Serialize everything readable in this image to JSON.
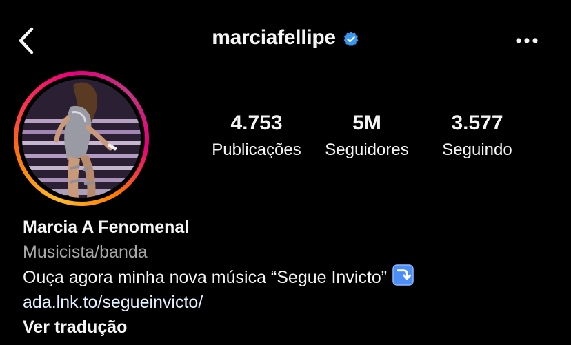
{
  "header": {
    "username": "marciafellipe",
    "back_icon": "chevron-left-icon",
    "verified_icon": "verified-badge-icon",
    "verified_color": "#3897f0",
    "more_icon": "more-horizontal-icon"
  },
  "profile": {
    "avatar": "profile-photo-of-performer-on-stage",
    "story_ring_colors": [
      "#fdbb2d",
      "#ff7a00",
      "#ff2d55",
      "#e6007a",
      "#c13584"
    ]
  },
  "stats": {
    "posts": {
      "value": "4.753",
      "label": "Publicações"
    },
    "followers": {
      "value": "5M",
      "label": "Seguidores"
    },
    "following": {
      "value": "3.577",
      "label": "Seguindo"
    }
  },
  "bio": {
    "name": "Marcia A Fenomenal",
    "category": "Musicista/banda",
    "text": "Ouça agora minha nova música “Segue Invicto”",
    "text_emoji": "arrow-turn-down-emoji",
    "link": "ada.lnk.to/segueinvicto/",
    "translate": "Ver tradução"
  },
  "colors": {
    "background": "#000000",
    "text": "#f5f5f5",
    "secondary_text": "#a8a8a8",
    "link": "#e0f1ff"
  }
}
